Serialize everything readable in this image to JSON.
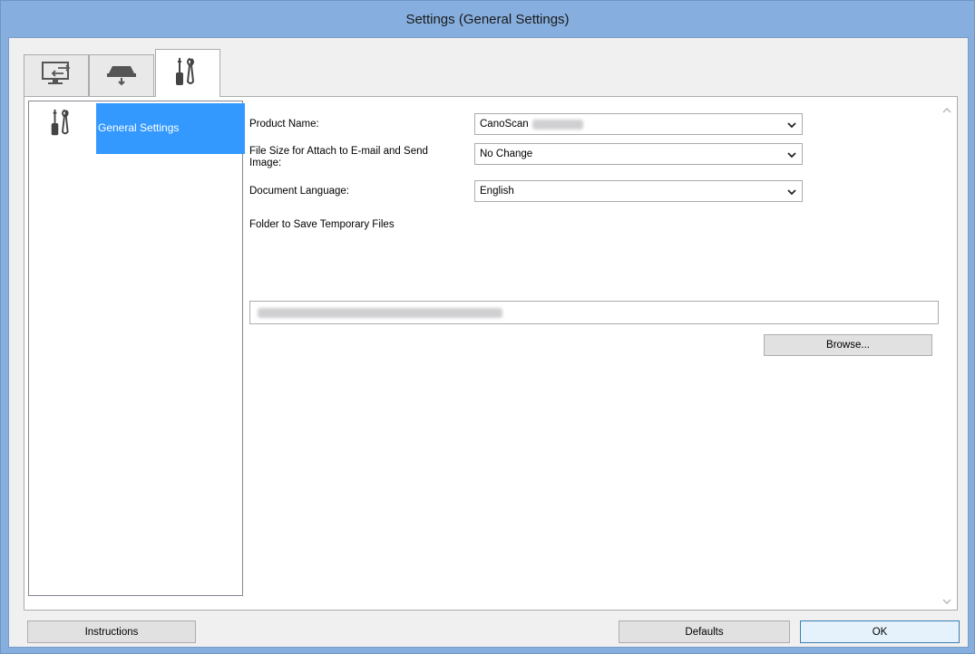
{
  "window": {
    "title": "Settings (General Settings)"
  },
  "tabs": [
    {
      "name": "scan-from-computer",
      "icon": "computer-scan-icon"
    },
    {
      "name": "scan-from-operation-panel",
      "icon": "scanner-icon"
    },
    {
      "name": "general-settings",
      "icon": "tools-icon",
      "active": true
    }
  ],
  "sidebar": {
    "items": [
      {
        "label": "General Settings",
        "icon": "tools-icon",
        "selected": true
      }
    ]
  },
  "form": {
    "product_name": {
      "label": "Product Name:",
      "value": "CanoScan"
    },
    "file_size": {
      "label": "File Size for Attach to E-mail and Send Image:",
      "value": "No Change"
    },
    "document_language": {
      "label": "Document Language:",
      "value": "English"
    },
    "temp_folder": {
      "label": "Folder to Save Temporary Files"
    },
    "browse_label": "Browse..."
  },
  "footer": {
    "instructions_label": "Instructions",
    "defaults_label": "Defaults",
    "ok_label": "OK"
  },
  "colors": {
    "titlebar": "#86aede",
    "selection": "#3399ff"
  }
}
